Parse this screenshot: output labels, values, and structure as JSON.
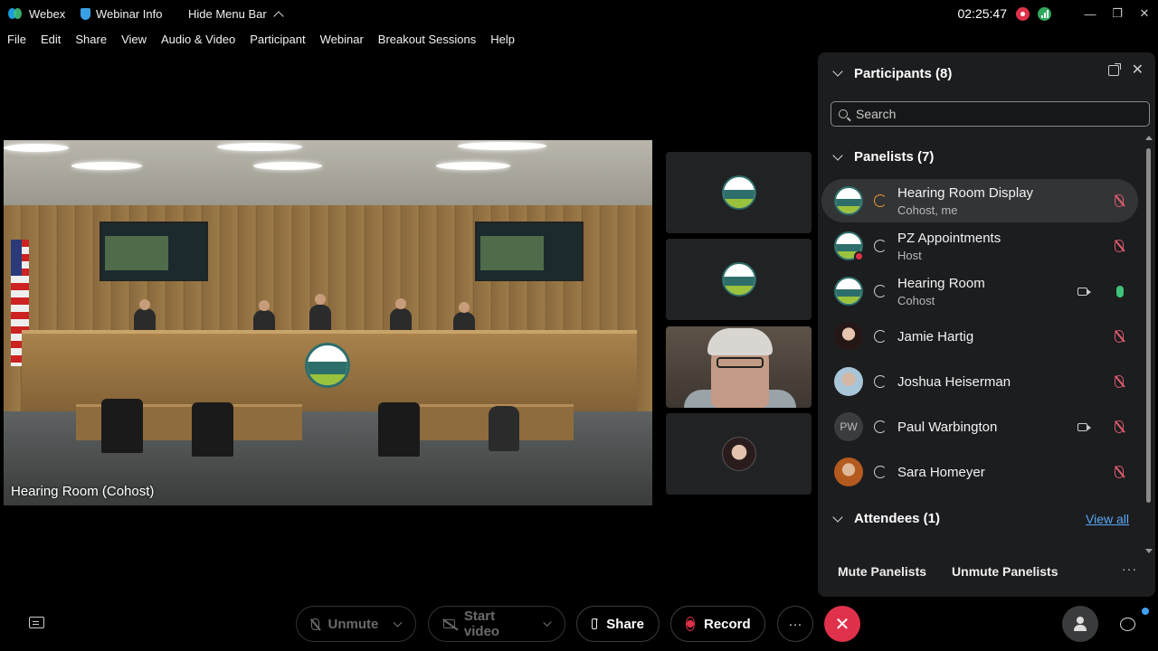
{
  "titlebar": {
    "app_name": "Webex",
    "webinar_info": "Webinar Info",
    "hide_menu_bar": "Hide Menu Bar",
    "clock": "02:25:47",
    "minimize": "—",
    "restore": "❐",
    "close": "✕"
  },
  "menu": [
    "File",
    "Edit",
    "Share",
    "View",
    "Audio & Video",
    "Participant",
    "Webinar",
    "Breakout Sessions",
    "Help"
  ],
  "main_video": {
    "label": "Hearing Room (Cohost)"
  },
  "participants_panel": {
    "title": "Participants (8)",
    "search_placeholder": "Search",
    "panelists_header": "Panelists (7)",
    "attendees_header": "Attendees (1)",
    "view_all": "View all",
    "mute_panelists": "Mute Panelists",
    "unmute_panelists": "Unmute Panelists",
    "more": "···",
    "panelists": [
      {
        "name": "Hearing Room Display",
        "role": "Cohost, me",
        "avatar": "logo",
        "mic": "muted"
      },
      {
        "name": "PZ Appointments",
        "role": "Host",
        "avatar": "logo",
        "mic": "muted"
      },
      {
        "name": "Hearing Room",
        "role": "Cohost",
        "avatar": "logo",
        "mic": "on",
        "video": true
      },
      {
        "name": "Jamie Hartig",
        "role": "",
        "avatar": "photo",
        "mic": "muted"
      },
      {
        "name": "Joshua Heiserman",
        "role": "",
        "avatar": "photo",
        "mic": "muted"
      },
      {
        "name": "Paul Warbington",
        "role": "",
        "avatar": "initials",
        "initials": "PW",
        "mic": "muted",
        "video": true
      },
      {
        "name": "Sara Homeyer",
        "role": "",
        "avatar": "photo",
        "mic": "muted"
      }
    ]
  },
  "toolbar": {
    "unmute": "Unmute",
    "start_video": "Start video",
    "share": "Share",
    "record": "Record",
    "more": "···",
    "leave": "✕"
  },
  "colors": {
    "leave": "#e0314b",
    "accent_link": "#58a8f5",
    "mic_on": "#3ec27a"
  }
}
